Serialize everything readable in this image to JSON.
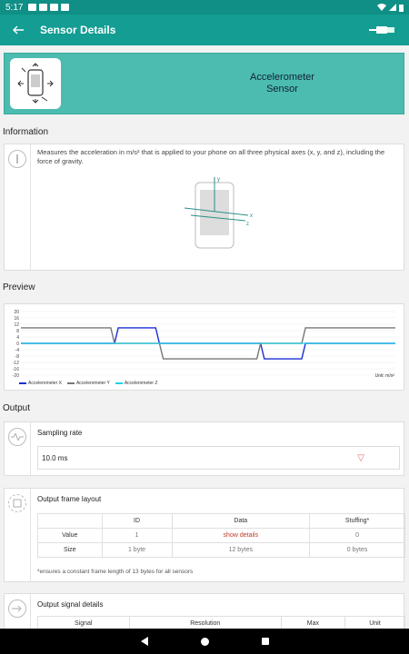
{
  "status": {
    "time": "5:17"
  },
  "appbar": {
    "title": "Sensor Details"
  },
  "header": {
    "title_line1": "Accelerometer",
    "title_line2": "Sensor"
  },
  "sections": {
    "information": "Information",
    "preview": "Preview",
    "output": "Output"
  },
  "information": {
    "text": "Measures the acceleration in m/s² that is applied to your phone on all three physical axes (x, y, and z), including the force of gravity.",
    "axis_y": "y",
    "axis_x": "x",
    "axis_z": "z"
  },
  "chart_data": {
    "type": "line",
    "y_ticks": [
      "20",
      "16",
      "12",
      "8",
      "4",
      "0",
      "-4",
      "-8",
      "-12",
      "-16",
      "-20"
    ],
    "ylim": [
      -20,
      20
    ],
    "unit_label": "Unit: m/s²",
    "legend_position": "bottom-left",
    "series": [
      {
        "name": "Accelerometer X",
        "color": "#1a2fd6",
        "values": [
          0,
          0,
          0,
          0,
          0,
          0,
          0,
          0,
          0,
          0,
          0,
          0,
          0,
          0,
          0,
          0,
          0,
          0,
          0,
          0,
          0,
          0,
          0,
          0,
          0,
          0,
          9.8,
          9.8,
          9.8,
          9.8,
          9.8,
          9.8,
          9.8,
          9.8,
          9.8,
          9.8,
          9.8,
          0,
          0,
          0,
          0,
          0,
          0,
          0,
          0,
          0,
          0,
          0,
          0,
          0,
          0,
          0,
          0,
          0,
          0,
          0,
          0,
          0,
          0,
          0,
          0,
          0,
          0,
          0,
          0,
          -9.8,
          -9.8,
          -9.8,
          -9.8,
          -9.8,
          -9.8,
          -9.8,
          -9.8,
          -9.8,
          -9.8,
          -9.8,
          0,
          0,
          0,
          0,
          0,
          0,
          0,
          0,
          0,
          0,
          0,
          0,
          0,
          0,
          0,
          0,
          0,
          0,
          0,
          0,
          0,
          0,
          0,
          0,
          0
        ]
      },
      {
        "name": "Accelerometer Y",
        "color": "#777777",
        "values": [
          9.8,
          9.8,
          9.8,
          9.8,
          9.8,
          9.8,
          9.8,
          9.8,
          9.8,
          9.8,
          9.8,
          9.8,
          9.8,
          9.8,
          9.8,
          9.8,
          9.8,
          9.8,
          9.8,
          9.8,
          9.8,
          9.8,
          9.8,
          9.8,
          9.8,
          0,
          0,
          0,
          0,
          0,
          0,
          0,
          0,
          0,
          0,
          0,
          0,
          0,
          -9.8,
          -9.8,
          -9.8,
          -9.8,
          -9.8,
          -9.8,
          -9.8,
          -9.8,
          -9.8,
          -9.8,
          -9.8,
          -9.8,
          -9.8,
          -9.8,
          -9.8,
          -9.8,
          -9.8,
          -9.8,
          -9.8,
          -9.8,
          -9.8,
          -9.8,
          -9.8,
          -9.8,
          -9.8,
          -9.8,
          0,
          0,
          0,
          0,
          0,
          0,
          0,
          0,
          0,
          0,
          0,
          0,
          9.8,
          9.8,
          9.8,
          9.8,
          9.8,
          9.8,
          9.8,
          9.8,
          9.8,
          9.8,
          9.8,
          9.8,
          9.8,
          9.8,
          9.8,
          9.8,
          9.8,
          9.8,
          9.8,
          9.8,
          9.8,
          9.8,
          9.8,
          9.8,
          9.8
        ]
      },
      {
        "name": "Accelerometer Z",
        "color": "#22d3e8",
        "values": [
          0,
          0,
          0,
          0,
          0,
          0,
          0,
          0,
          0,
          0,
          0,
          0,
          0,
          0,
          0,
          0,
          0,
          0,
          0,
          0,
          0,
          0,
          0,
          0,
          0,
          0,
          0,
          0,
          0,
          0,
          0,
          0,
          0,
          0,
          0,
          0,
          0,
          0,
          0,
          0,
          0,
          0,
          0,
          0,
          0,
          0,
          0,
          0,
          0,
          0,
          0,
          0,
          0,
          0,
          0,
          0,
          0,
          0,
          0,
          0,
          0,
          0,
          0,
          0,
          0,
          0,
          0,
          0,
          0,
          0,
          0,
          0,
          0,
          0,
          0,
          0,
          0,
          0,
          0,
          0,
          0,
          0,
          0,
          0,
          0,
          0,
          0,
          0,
          0,
          0,
          0,
          0,
          0,
          0,
          0,
          0,
          0,
          0,
          0,
          0
        ]
      }
    ]
  },
  "sampling": {
    "label": "Sampling rate",
    "value": "10.0 ms"
  },
  "frame_layout": {
    "title": "Output frame layout",
    "headers": [
      "",
      "ID",
      "Data",
      "Stuffing*"
    ],
    "rows": [
      [
        "Value",
        "1",
        "show details",
        "0"
      ],
      [
        "Size",
        "1 byte",
        "12 bytes",
        "0 bytes"
      ]
    ],
    "note": "*ensures a constant frame length of 13 bytes for all sensors"
  },
  "signal_details": {
    "title": "Output signal details",
    "headers": [
      "Signal",
      "Resolution",
      "Max",
      "Unit"
    ]
  },
  "colors": {
    "teal_dark": "#0f8f85",
    "teal": "#139d93",
    "header_bg": "#4cbcb0"
  },
  "icons": {
    "back": "back-arrow-icon",
    "plug": "usb-plug-icon"
  }
}
